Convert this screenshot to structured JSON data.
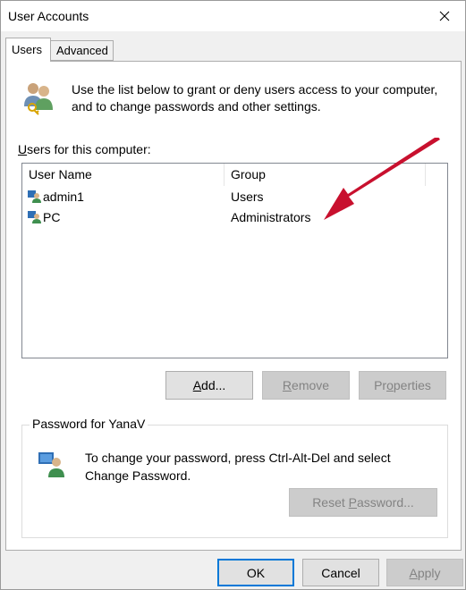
{
  "window": {
    "title": "User Accounts"
  },
  "tabs": [
    {
      "label": "Users",
      "active": true
    },
    {
      "label": "Advanced",
      "active": false
    }
  ],
  "intro_text": "Use the list below to grant or deny users access to your computer, and to change passwords and other settings.",
  "users_label": "Users for this computer:",
  "list": {
    "columns": [
      "User Name",
      "Group"
    ],
    "rows": [
      {
        "name": "admin1",
        "group": "Users"
      },
      {
        "name": "PC",
        "group": "Administrators"
      }
    ]
  },
  "buttons": {
    "add": "Add...",
    "remove": "Remove",
    "properties": "Properties",
    "reset_password": "Reset Password...",
    "ok": "OK",
    "cancel": "Cancel",
    "apply": "Apply"
  },
  "password_group": {
    "title": "Password for YanaV",
    "text": "To change your password, press Ctrl-Alt-Del and select Change Password."
  },
  "colors": {
    "arrow": "#c8102e",
    "focus_border": "#0078d7"
  }
}
